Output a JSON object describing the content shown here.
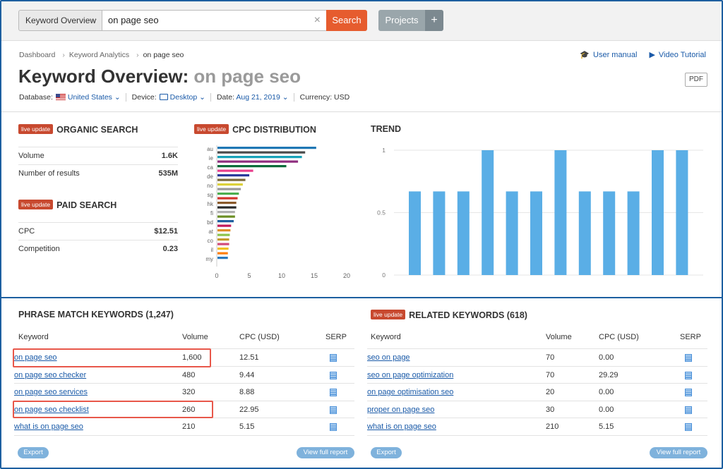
{
  "topbar": {
    "database_select": "Keyword Overview",
    "search_value": "on page seo",
    "search_button": "Search",
    "projects_button": "Projects",
    "plus_button": "+"
  },
  "breadcrumb": [
    "Dashboard",
    "Keyword Analytics",
    "on page seo"
  ],
  "help": {
    "user_manual": "User manual",
    "video_tutorial": "Video Tutorial"
  },
  "page": {
    "title_prefix": "Keyword Overview:",
    "title_keyword": "on page seo",
    "pdf": "PDF"
  },
  "filters": {
    "database_label": "Database:",
    "database_value": "United States",
    "device_label": "Device:",
    "device_value": "Desktop",
    "date_label": "Date:",
    "date_value": "Aug 21, 2019",
    "currency_label": "Currency:",
    "currency_value": "USD"
  },
  "badge": "live update",
  "organic": {
    "title": "ORGANIC SEARCH",
    "rows": [
      {
        "label": "Volume",
        "value": "1.6K"
      },
      {
        "label": "Number of results",
        "value": "535M"
      }
    ]
  },
  "paid": {
    "title": "PAID SEARCH",
    "rows": [
      {
        "label": "CPC",
        "value": "$12.51"
      },
      {
        "label": "Competition",
        "value": "0.23"
      }
    ]
  },
  "cpc_title": "CPC DISTRIBUTION",
  "trend_title": "TREND",
  "chart_data": [
    {
      "type": "bar",
      "orientation": "horizontal",
      "title": "CPC DISTRIBUTION",
      "tick_labels_y": [
        "au",
        "ie",
        "ca",
        "de",
        "no",
        "sg",
        "hk",
        "fi",
        "bd",
        "at",
        "co",
        "il",
        "my"
      ],
      "values": [
        15.2,
        13.5,
        13.0,
        12.4,
        10.6,
        5.5,
        4.9,
        4.3,
        3.9,
        3.6,
        3.3,
        3.1,
        2.9,
        2.9,
        2.7,
        2.7,
        2.5,
        2.1,
        2.0,
        1.9,
        1.8,
        1.8,
        1.7,
        1.6,
        1.6
      ],
      "colors": [
        "#1f77b4",
        "#4a4a4a",
        "#17a2b8",
        "#8e2c7e",
        "#0a6b3a",
        "#e83e8c",
        "#2a3a9c",
        "#7a6a3a",
        "#dcd13a",
        "#9a9a9a",
        "#4caf50",
        "#d3352d",
        "#8a5a2a",
        "#2a2a2a",
        "#b0b0b0",
        "#6b8e23",
        "#1f5fa0",
        "#c2185b",
        "#e08e2a",
        "#8bc34a",
        "#c49a2a",
        "#d34a7a",
        "#f0c020",
        "#ff7f0e",
        "#2a7ac0"
      ],
      "xlim": [
        0,
        20
      ],
      "x_ticks": [
        "0",
        "5",
        "10",
        "15",
        "20"
      ]
    },
    {
      "type": "bar",
      "title": "TREND",
      "values": [
        0.67,
        0.67,
        0.67,
        1,
        0.67,
        0.67,
        1,
        0.67,
        0.67,
        0.67,
        1,
        1
      ],
      "ylim": [
        0,
        1
      ],
      "y_ticks": [
        "0",
        "0.5",
        "1"
      ],
      "color": "#5aaee6"
    }
  ],
  "phrase": {
    "title": "PHRASE MATCH KEYWORDS (1,247)",
    "headers": [
      "Keyword",
      "Volume",
      "CPC (USD)",
      "SERP"
    ],
    "rows": [
      {
        "keyword": "on page seo",
        "volume": "1,600",
        "cpc": "12.51"
      },
      {
        "keyword": "on page seo checker",
        "volume": "480",
        "cpc": "9.44"
      },
      {
        "keyword": "on page seo services",
        "volume": "320",
        "cpc": "8.88"
      },
      {
        "keyword": "on page seo checklist",
        "volume": "260",
        "cpc": "22.95"
      },
      {
        "keyword": "what is on page seo",
        "volume": "210",
        "cpc": "5.15"
      }
    ],
    "export": "Export",
    "view_full": "View full report"
  },
  "related": {
    "title": "RELATED KEYWORDS (618)",
    "headers": [
      "Keyword",
      "Volume",
      "CPC (USD)",
      "SERP"
    ],
    "rows": [
      {
        "keyword": "seo on page",
        "volume": "70",
        "cpc": "0.00"
      },
      {
        "keyword": "seo on page optimization",
        "volume": "70",
        "cpc": "29.29"
      },
      {
        "keyword": "on page optimisation seo",
        "volume": "20",
        "cpc": "0.00"
      },
      {
        "keyword": "proper on page seo",
        "volume": "30",
        "cpc": "0.00"
      },
      {
        "keyword": "what is on page seo",
        "volume": "210",
        "cpc": "5.15"
      }
    ],
    "export": "Export",
    "view_full": "View full report"
  }
}
